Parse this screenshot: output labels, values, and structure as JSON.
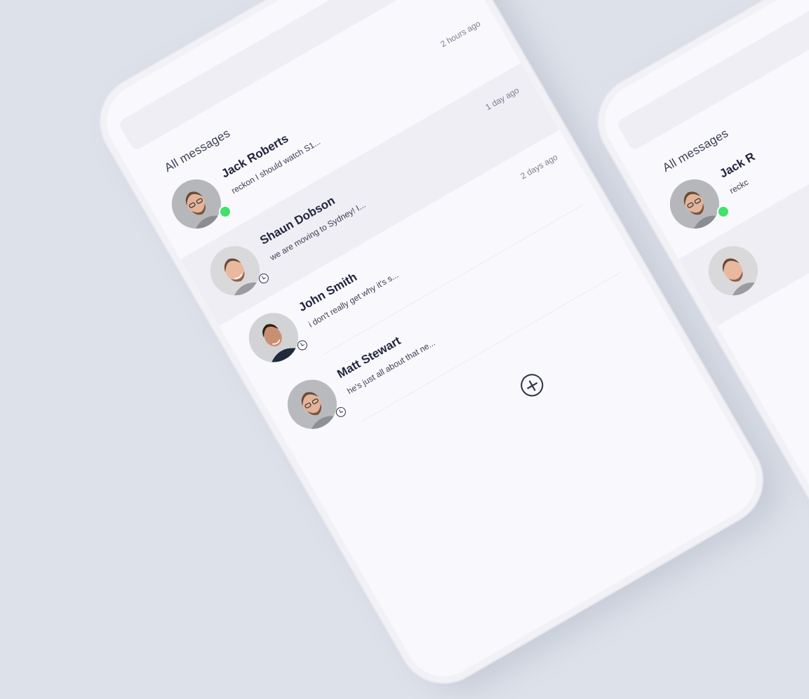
{
  "messages_section": {
    "title": "All messages",
    "conversations": [
      {
        "name": "Jack Roberts",
        "preview": "reckon I should watch S1...",
        "time": "2 hours ago",
        "status": "online"
      },
      {
        "name": "Shaun Dobson",
        "preview": "we are moving to Sydney! I...",
        "time": "1 day ago",
        "status": "away"
      },
      {
        "name": "John Smith",
        "preview": "i don't really get why it's s...",
        "time": "2 days ago",
        "status": "away"
      },
      {
        "name": "Matt Stewart",
        "preview": "he's just all about that ne...",
        "time": "",
        "status": "away"
      }
    ]
  },
  "second_screen": {
    "title": "All messages",
    "first_name": "Jack R",
    "first_preview": "reckc"
  },
  "colors": {
    "background": "#dde1ea",
    "online": "#3fe26a",
    "text_dark": "#22253d",
    "highlight_row": "#efeef4"
  },
  "icons": {
    "add": "plus-icon",
    "online": "online-dot-icon",
    "away": "clock-icon"
  }
}
